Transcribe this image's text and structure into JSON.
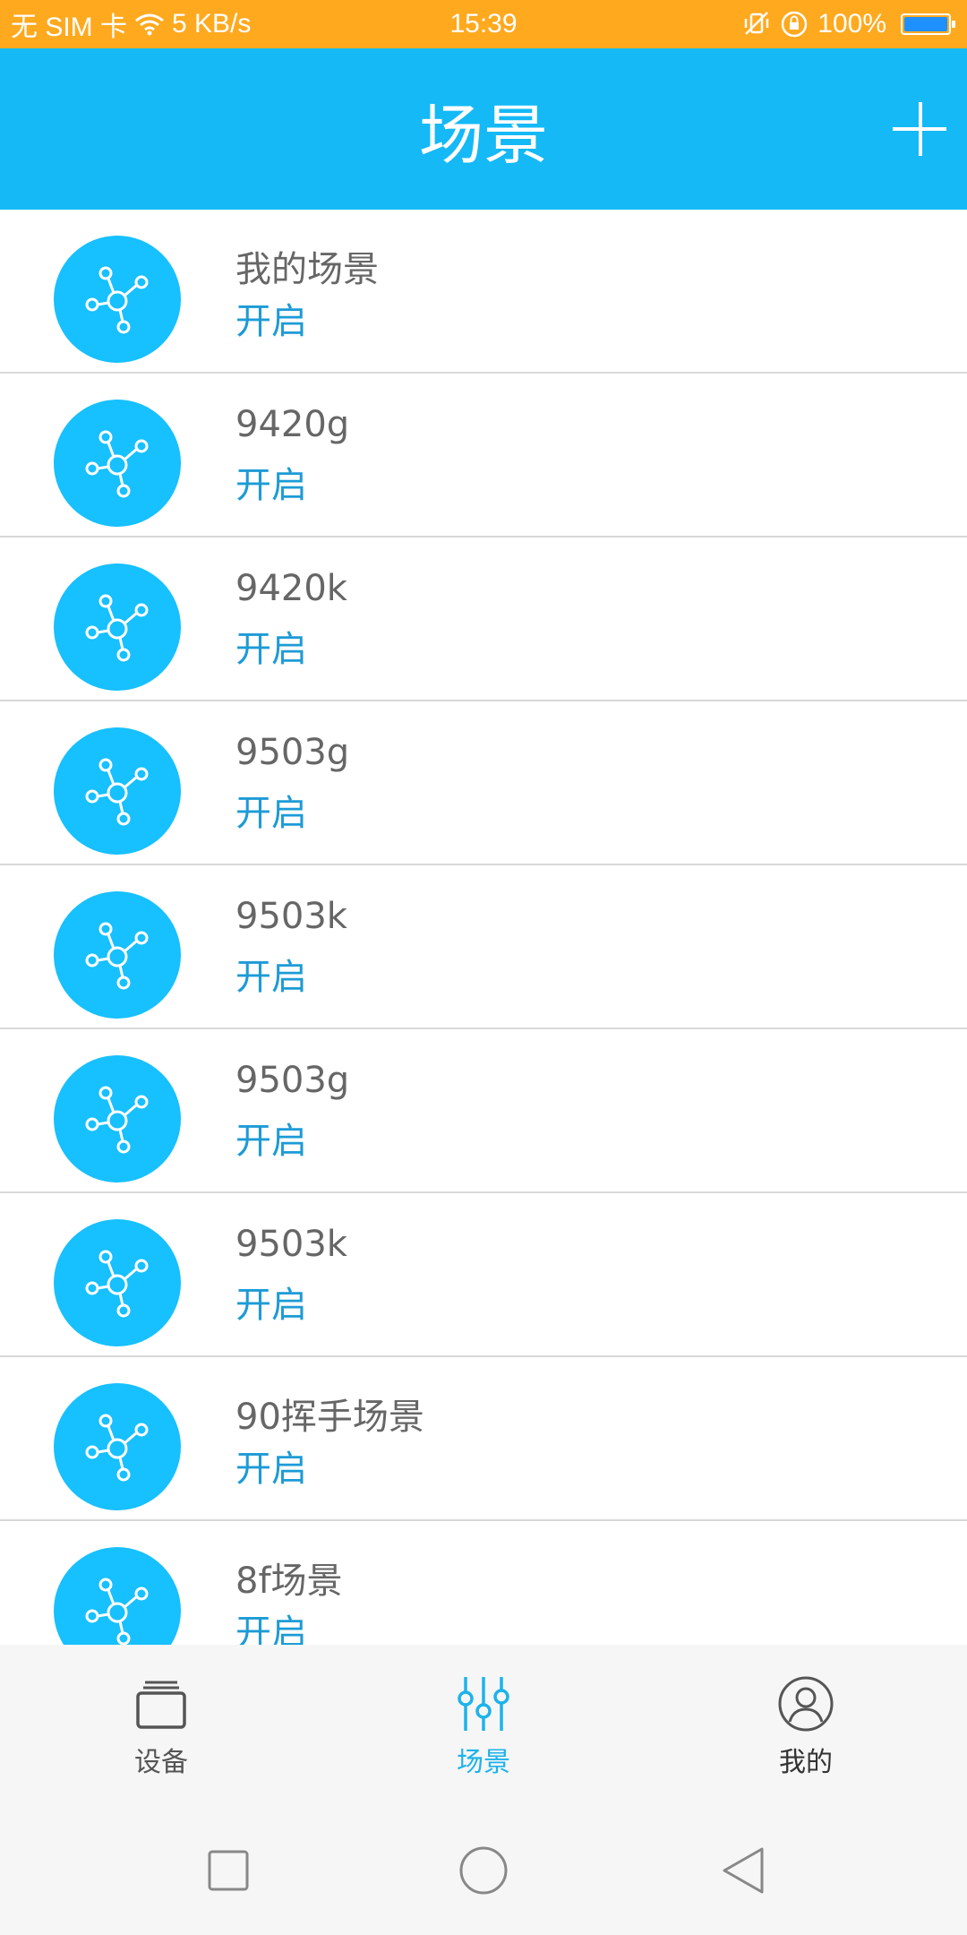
{
  "status_bar": {
    "carrier": "无 SIM 卡",
    "net_speed": "5 KB/s",
    "time": "15:39",
    "battery": "100%",
    "battery_level": 1.0
  },
  "header": {
    "title": "场景",
    "add_icon": "plus-icon"
  },
  "scenes": [
    {
      "name": "我的场景",
      "status": "开启"
    },
    {
      "name": "9420g",
      "status": "开启"
    },
    {
      "name": "9420k",
      "status": "开启"
    },
    {
      "name": "9503g",
      "status": "开启"
    },
    {
      "name": "9503k",
      "status": "开启"
    },
    {
      "name": "9503g",
      "status": "开启"
    },
    {
      "name": "9503k",
      "status": "开启"
    },
    {
      "name": "90挥手场景",
      "status": "开启"
    },
    {
      "name": "8f场景",
      "status": "开启"
    }
  ],
  "tabs": [
    {
      "label": "设备",
      "icon": "device-icon",
      "active": false
    },
    {
      "label": "场景",
      "icon": "sliders-icon",
      "active": true
    },
    {
      "label": "我的",
      "icon": "profile-icon",
      "active": false
    }
  ],
  "colors": {
    "status_bar": "#ffa91f",
    "header": "#14b9f6",
    "scene_icon_bg": "#17c0ff",
    "status_text": "#1d9bd6",
    "tab_active": "#1cb3ea",
    "tab_inactive": "#555555"
  }
}
